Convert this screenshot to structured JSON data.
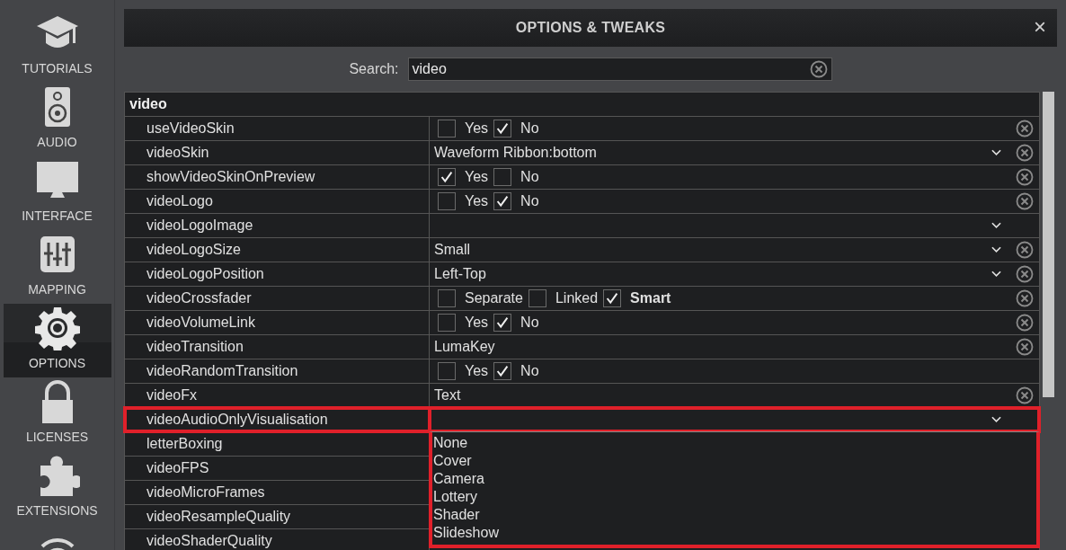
{
  "sidebar": {
    "items": [
      {
        "label": "TUTORIALS",
        "kind": "cap",
        "selected": false
      },
      {
        "label": "AUDIO",
        "kind": "speaker",
        "selected": false
      },
      {
        "label": "INTERFACE",
        "kind": "monitor",
        "selected": false
      },
      {
        "label": "MAPPING",
        "kind": "sliders",
        "selected": false
      },
      {
        "label": "OPTIONS",
        "kind": "gear",
        "selected": true
      },
      {
        "label": "LICENSES",
        "kind": "lock",
        "selected": false
      },
      {
        "label": "EXTENSIONS",
        "kind": "puzzle",
        "selected": false
      },
      {
        "kind": "signal",
        "selected": false
      }
    ]
  },
  "dialog": {
    "title": "OPTIONS & TWEAKS",
    "close": "×"
  },
  "search": {
    "label": "Search:",
    "value": "video"
  },
  "table": {
    "group": "video",
    "rows": [
      {
        "name": "useVideoSkin",
        "kind": "checks",
        "clear": true,
        "options": [
          {
            "label": "Yes",
            "checked": false
          },
          {
            "label": "No",
            "checked": true
          }
        ]
      },
      {
        "name": "videoSkin",
        "kind": "select",
        "value": "Waveform Ribbon:bottom",
        "clear": true
      },
      {
        "name": "showVideoSkinOnPreview",
        "kind": "checks",
        "clear": true,
        "options": [
          {
            "label": "Yes",
            "checked": true
          },
          {
            "label": "No",
            "checked": false
          }
        ]
      },
      {
        "name": "videoLogo",
        "kind": "checks",
        "clear": true,
        "options": [
          {
            "label": "Yes",
            "checked": false
          },
          {
            "label": "No",
            "checked": true
          }
        ]
      },
      {
        "name": "videoLogoImage",
        "kind": "select"
      },
      {
        "name": "videoLogoSize",
        "kind": "select",
        "value": "Small",
        "clear": true
      },
      {
        "name": "videoLogoPosition",
        "kind": "select",
        "value": "Left-Top",
        "clear": true
      },
      {
        "name": "videoCrossfader",
        "kind": "checks",
        "clear": true,
        "options": [
          {
            "label": "Separate",
            "checked": false,
            "bold": false
          },
          {
            "label": "Linked",
            "checked": false,
            "bold": false
          },
          {
            "label": "Smart",
            "checked": true,
            "bold": true
          }
        ]
      },
      {
        "name": "videoVolumeLink",
        "kind": "checks",
        "clear": true,
        "options": [
          {
            "label": "Yes",
            "checked": false
          },
          {
            "label": "No",
            "checked": true
          }
        ]
      },
      {
        "name": "videoTransition",
        "kind": "text",
        "value": "LumaKey",
        "clear": true
      },
      {
        "name": "videoRandomTransition",
        "kind": "checks",
        "options": [
          {
            "label": "Yes",
            "checked": false
          },
          {
            "label": "No",
            "checked": true
          }
        ]
      },
      {
        "name": "videoFx",
        "kind": "text",
        "value": "Text",
        "clear": true
      },
      {
        "name": "videoAudioOnlyVisualisation",
        "kind": "select",
        "highlighted": true,
        "expanded": true,
        "dropdown": [
          "None",
          "Cover",
          "Camera",
          "Lottery",
          "Shader",
          "Slideshow"
        ]
      },
      {
        "name": "letterBoxing",
        "kind": "text"
      },
      {
        "name": "videoFPS",
        "kind": "text"
      },
      {
        "name": "videoMicroFrames",
        "kind": "text"
      },
      {
        "name": "videoResampleQuality",
        "kind": "text"
      },
      {
        "name": "videoShaderQuality",
        "kind": "text"
      }
    ]
  }
}
